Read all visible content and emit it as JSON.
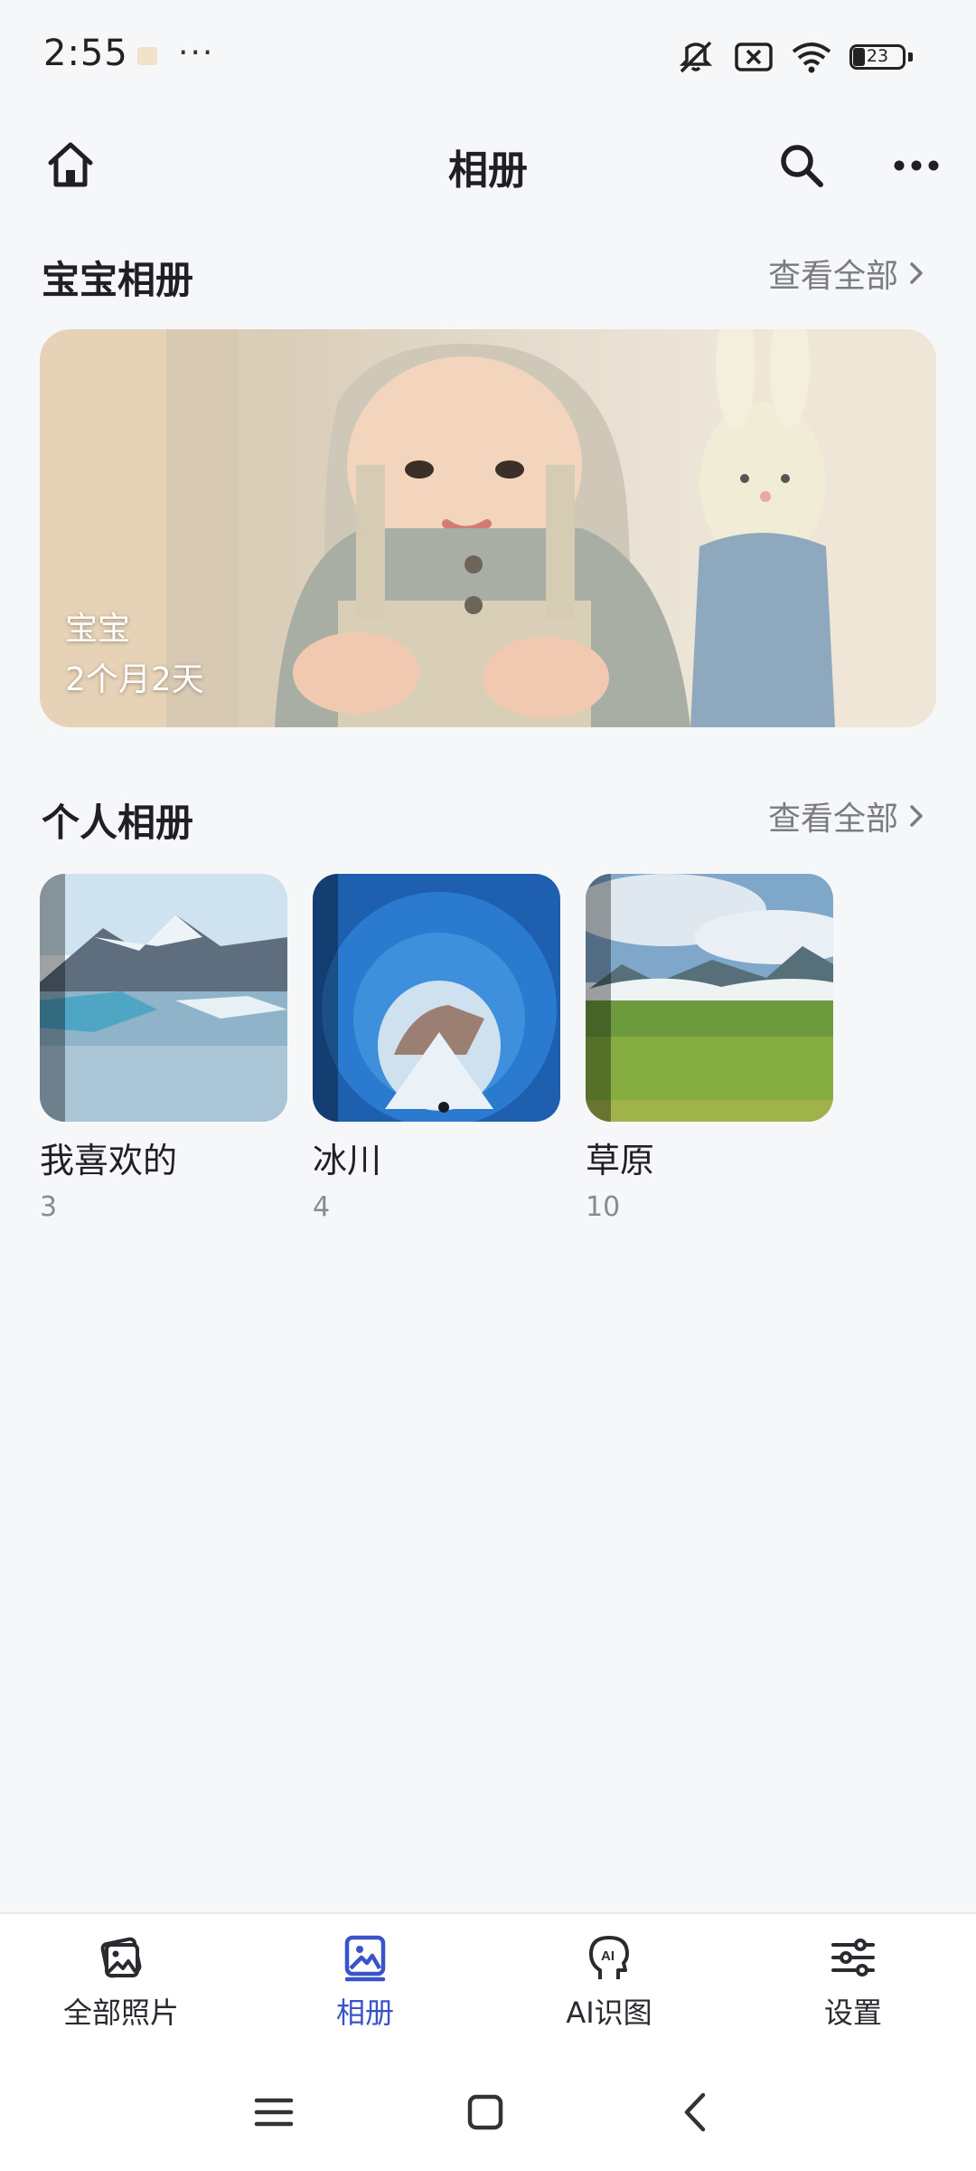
{
  "status_bar": {
    "time": "2:55",
    "dots": "···",
    "battery": "23",
    "icons": [
      "small-notification-icon",
      "vibrate-off-icon",
      "sim-x-icon",
      "wifi-icon",
      "battery-icon"
    ]
  },
  "header": {
    "title": "相册",
    "icons": [
      "home-icon",
      "search-icon",
      "more-icon"
    ]
  },
  "baby_section": {
    "title": "宝宝相册",
    "see_all": "查看全部",
    "card": {
      "name": "宝宝",
      "age": "2个月2天"
    }
  },
  "personal_section": {
    "title": "个人相册",
    "see_all": "查看全部",
    "albums": [
      {
        "name": "我喜欢的",
        "count": "3"
      },
      {
        "name": "冰川",
        "count": "4"
      },
      {
        "name": "草原",
        "count": "10"
      }
    ]
  },
  "bottom_nav": {
    "items": [
      {
        "label": "全部照片",
        "icon": "photos-icon",
        "active": false
      },
      {
        "label": "相册",
        "icon": "album-icon",
        "active": true
      },
      {
        "label": "AI识图",
        "icon": "ai-head-icon",
        "active": false
      },
      {
        "label": "设置",
        "icon": "settings-sliders-icon",
        "active": false
      }
    ]
  },
  "colors": {
    "background": "#f6f7f9",
    "accent": "#3953c8",
    "text_primary": "#1f1f24",
    "text_secondary": "#7b7c82"
  }
}
